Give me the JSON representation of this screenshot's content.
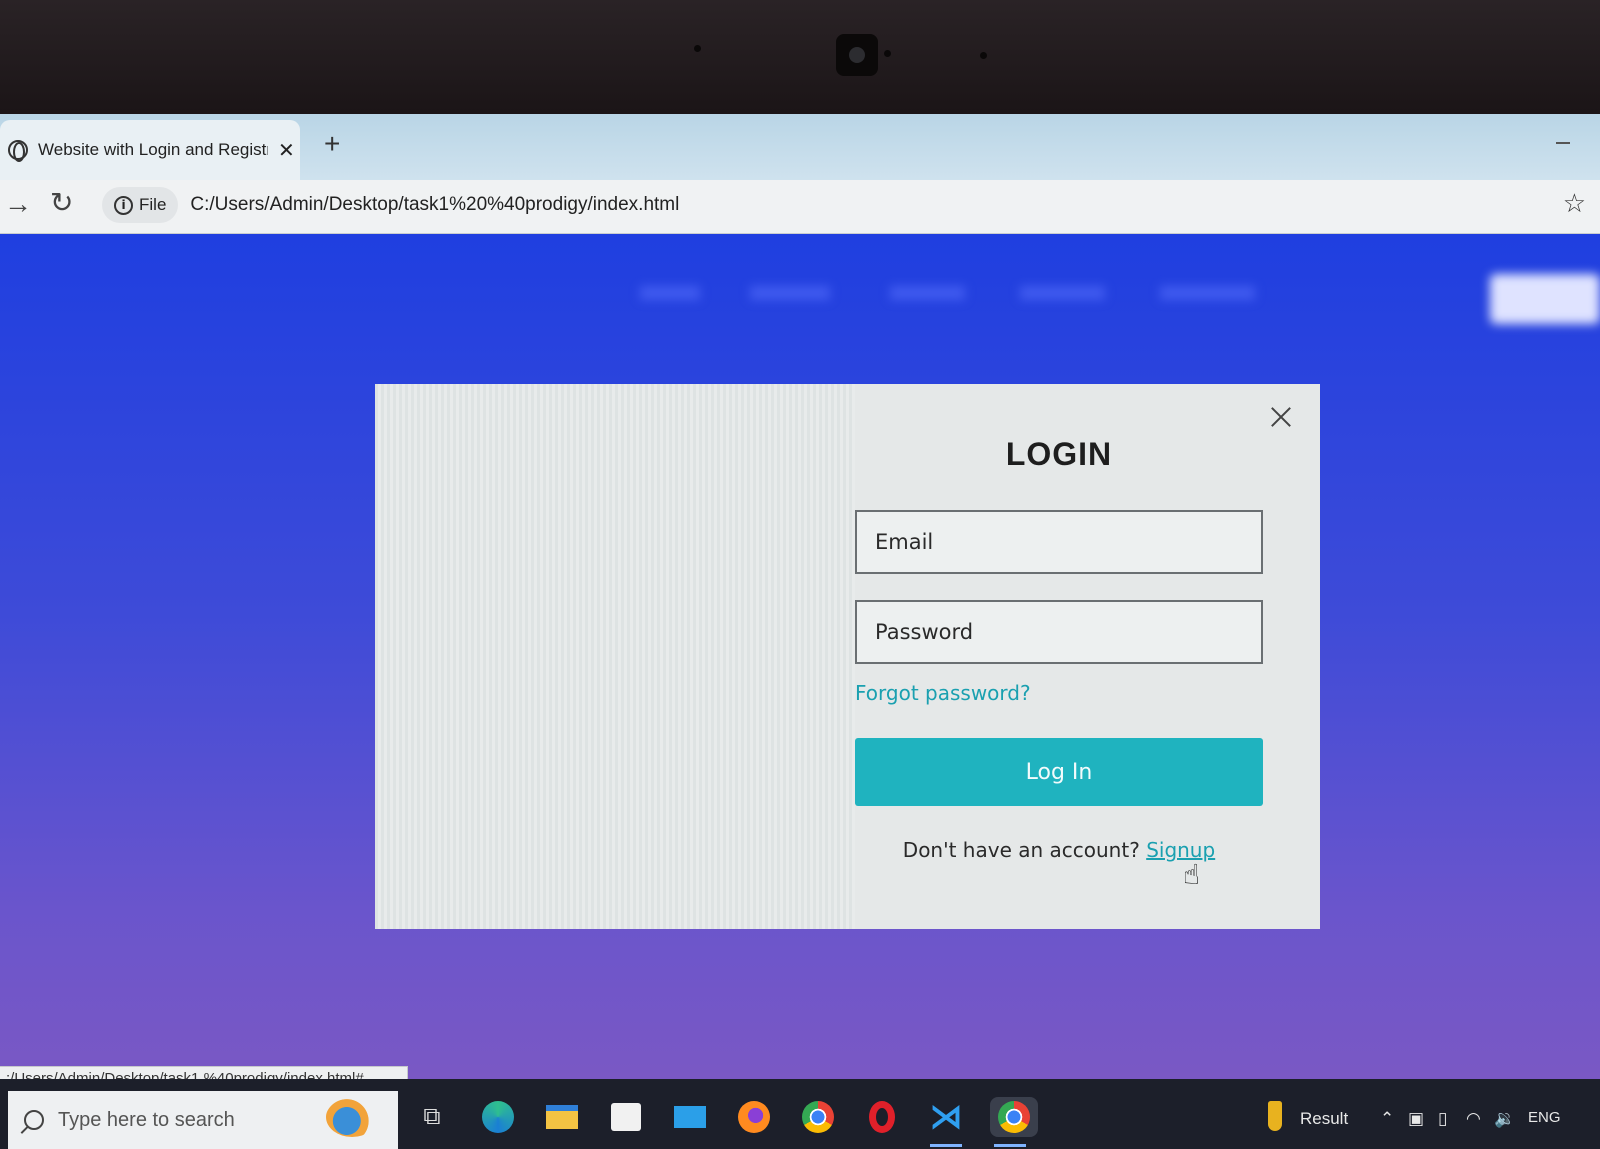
{
  "browser": {
    "tab_title": "Website with Login and Registr",
    "tab_close": "✕",
    "new_tab": "+",
    "file_chip": "File",
    "url": "C:/Users/Admin/Desktop/task1%20%40prodigy/index.html",
    "status_url": ":/Users/Admin/Desktop/task1 %40prodigy/index.html#"
  },
  "login": {
    "title": "LOGIN",
    "email_placeholder": "Email",
    "password_placeholder": "Password",
    "forgot_label": "Forgot password?",
    "login_button": "Log In",
    "signup_prompt": "Don't have an account?",
    "signup_link": "Signup"
  },
  "taskbar": {
    "search_placeholder": "Type here to search",
    "pinned": [
      "task-view-icon",
      "edge-icon",
      "file-explorer-icon",
      "store-icon",
      "mail-icon",
      "firefox-icon",
      "chrome-icon",
      "opera-icon",
      "vscode-icon",
      "chrome-icon"
    ],
    "widget_label": "Result",
    "language": "ENG"
  },
  "colors": {
    "accent": "#1fb3bf",
    "link": "#1aa0b0",
    "page_gradient_top": "#1f3fe0",
    "page_gradient_bottom": "#7a58c4"
  }
}
